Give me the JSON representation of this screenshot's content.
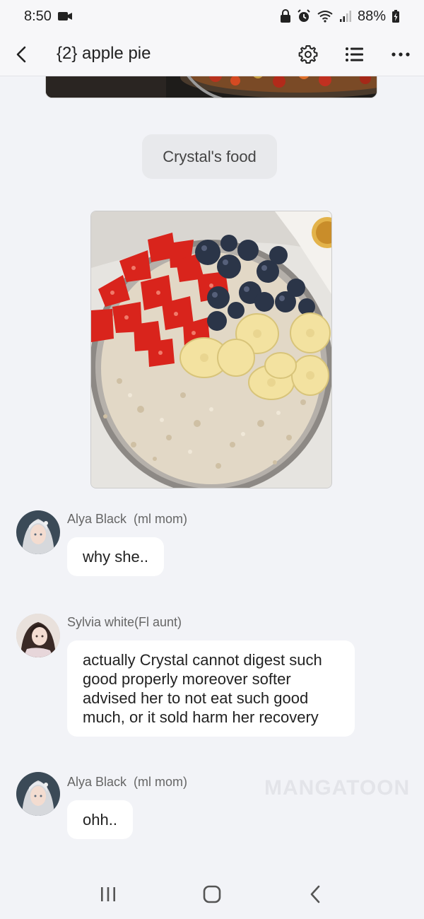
{
  "status_bar": {
    "time": "8:50",
    "battery": "88%",
    "icons": [
      "video-camera-icon",
      "lock-icon",
      "alarm-icon",
      "wifi-icon",
      "signal-icon",
      "battery-charging-icon"
    ]
  },
  "header": {
    "title": "{2} apple pie",
    "icons": [
      "back-icon",
      "settings-gear-icon",
      "list-icon",
      "more-icon"
    ]
  },
  "chat": {
    "system_message": "Crystal's food",
    "messages": [
      {
        "name": "Alya Black",
        "role": "(ml mom)",
        "text": "why she.."
      },
      {
        "name": "Sylvia white(Fl aunt)",
        "role": "",
        "text": "actually Crystal cannot digest such good properly moreover softer advised her to not eat such good much, or it sold harm her recovery"
      },
      {
        "name": "Alya Black",
        "role": "(ml mom)",
        "text": "ohh.."
      }
    ]
  },
  "watermark": "MANGATOON",
  "nav_bar": {
    "icons": [
      "recent-apps-icon",
      "home-icon",
      "back-nav-icon"
    ]
  },
  "colors": {
    "background": "#f2f3f7",
    "bubble": "#ffffff",
    "pill": "#e8e9ec"
  }
}
